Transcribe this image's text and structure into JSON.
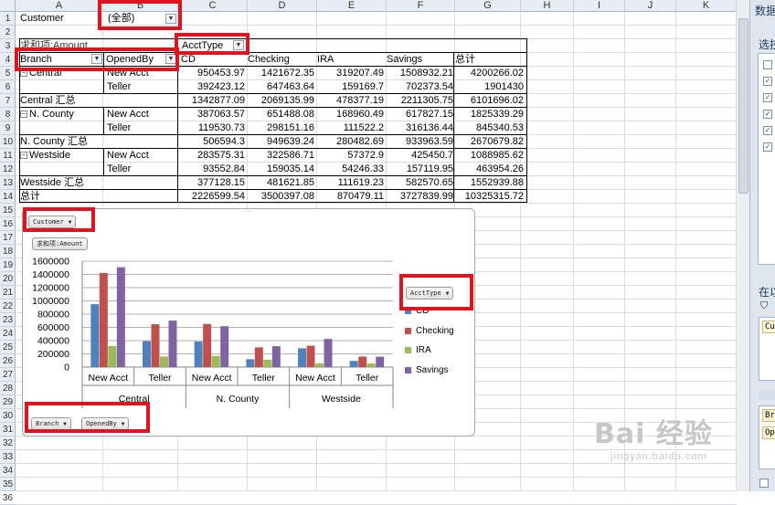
{
  "columns": [
    "A",
    "B",
    "C",
    "D",
    "E",
    "F",
    "G",
    "H",
    "I",
    "J",
    "K"
  ],
  "rows": [
    "1",
    "2",
    "3",
    "4",
    "5",
    "6",
    "7",
    "8",
    "9",
    "10",
    "11",
    "12",
    "13",
    "14",
    "15",
    "16",
    "17",
    "18",
    "19",
    "20",
    "21",
    "22",
    "23",
    "24",
    "25",
    "26",
    "27",
    "28",
    "29",
    "30",
    "31",
    "32",
    "33",
    "34",
    "35",
    "36"
  ],
  "page_filter": {
    "label": "Customer",
    "value": "(全部)"
  },
  "pivot": {
    "data_field": "求和项:Amount",
    "col_field": "AcctType",
    "row_fields": [
      "Branch",
      "OpenedBy"
    ],
    "col_headers": [
      "CD",
      "Checking",
      "IRA",
      "Savings",
      "总计"
    ],
    "body": [
      {
        "branch": "Central",
        "opened": "New Acct",
        "vals": [
          "950453.97",
          "1421672.35",
          "319207.49",
          "1508932.21",
          "4200266.02"
        ]
      },
      {
        "branch": "",
        "opened": "Teller",
        "vals": [
          "392423.12",
          "647463.64",
          "159169.7",
          "702373.54",
          "1901430"
        ]
      },
      {
        "branch": "Central 汇总",
        "opened": "",
        "vals": [
          "1342877.09",
          "2069135.99",
          "478377.19",
          "2211305.75",
          "6101696.02"
        ]
      },
      {
        "branch": "N. County",
        "opened": "New Acct",
        "vals": [
          "387063.57",
          "651488.08",
          "168960.49",
          "617827.15",
          "1825339.29"
        ]
      },
      {
        "branch": "",
        "opened": "Teller",
        "vals": [
          "119530.73",
          "298151.16",
          "111522.2",
          "316136.44",
          "845340.53"
        ]
      },
      {
        "branch": "N. County 汇总",
        "opened": "",
        "vals": [
          "506594.3",
          "949639.24",
          "280482.69",
          "933963.59",
          "2670679.82"
        ]
      },
      {
        "branch": "Westside",
        "opened": "New Acct",
        "vals": [
          "283575.31",
          "322586.71",
          "57372.9",
          "425450.7",
          "1088985.62"
        ]
      },
      {
        "branch": "",
        "opened": "Teller",
        "vals": [
          "93552.84",
          "159035.14",
          "54246.33",
          "157119.95",
          "463954.26"
        ]
      },
      {
        "branch": "Westside 汇总",
        "opened": "",
        "vals": [
          "377128.15",
          "481621.85",
          "111619.23",
          "582570.65",
          "1552939.88"
        ]
      },
      {
        "branch": "总计",
        "opened": "",
        "vals": [
          "2226599.54",
          "3500397.08",
          "870479.11",
          "3727839.99",
          "10325315.72"
        ]
      }
    ]
  },
  "chart_buttons": {
    "customer": "Customer",
    "values": "求和项:Amount",
    "accttype": "AcctType",
    "branch": "Branch",
    "openedby": "OpenedBy"
  },
  "chart_data": {
    "type": "bar",
    "categories": [
      "New Acct",
      "Teller",
      "New Acct",
      "Teller",
      "New Acct",
      "Teller"
    ],
    "groups": [
      "Central",
      "N. County",
      "Westside"
    ],
    "series": [
      {
        "name": "CD",
        "color": "#4f81bd",
        "values": [
          950453.97,
          392423.12,
          387063.57,
          119530.73,
          283575.31,
          93552.84
        ]
      },
      {
        "name": "Checking",
        "color": "#c0504d",
        "values": [
          1421672.35,
          647463.64,
          651488.08,
          298151.16,
          322586.71,
          159035.14
        ]
      },
      {
        "name": "IRA",
        "color": "#9bbb59",
        "values": [
          319207.49,
          159169.7,
          168960.49,
          111522.2,
          57372.9,
          54246.33
        ]
      },
      {
        "name": "Savings",
        "color": "#8064a2",
        "values": [
          1508932.21,
          702373.54,
          617827.15,
          316136.44,
          425450.7,
          157119.95
        ]
      }
    ],
    "yticks": [
      "1600000",
      "1400000",
      "1200000",
      "1000000",
      "800000",
      "600000",
      "400000",
      "200000",
      "0"
    ],
    "ylim": [
      0,
      1600000
    ],
    "grid": true,
    "legend": "right"
  },
  "right_pane": {
    "title": "数据",
    "section": "选技",
    "area": "在以",
    "cv": "Cu",
    "br": "Br",
    "op": "Op"
  },
  "watermark": {
    "big": "Bai 经验",
    "small": "jingyan.baidu.com"
  }
}
